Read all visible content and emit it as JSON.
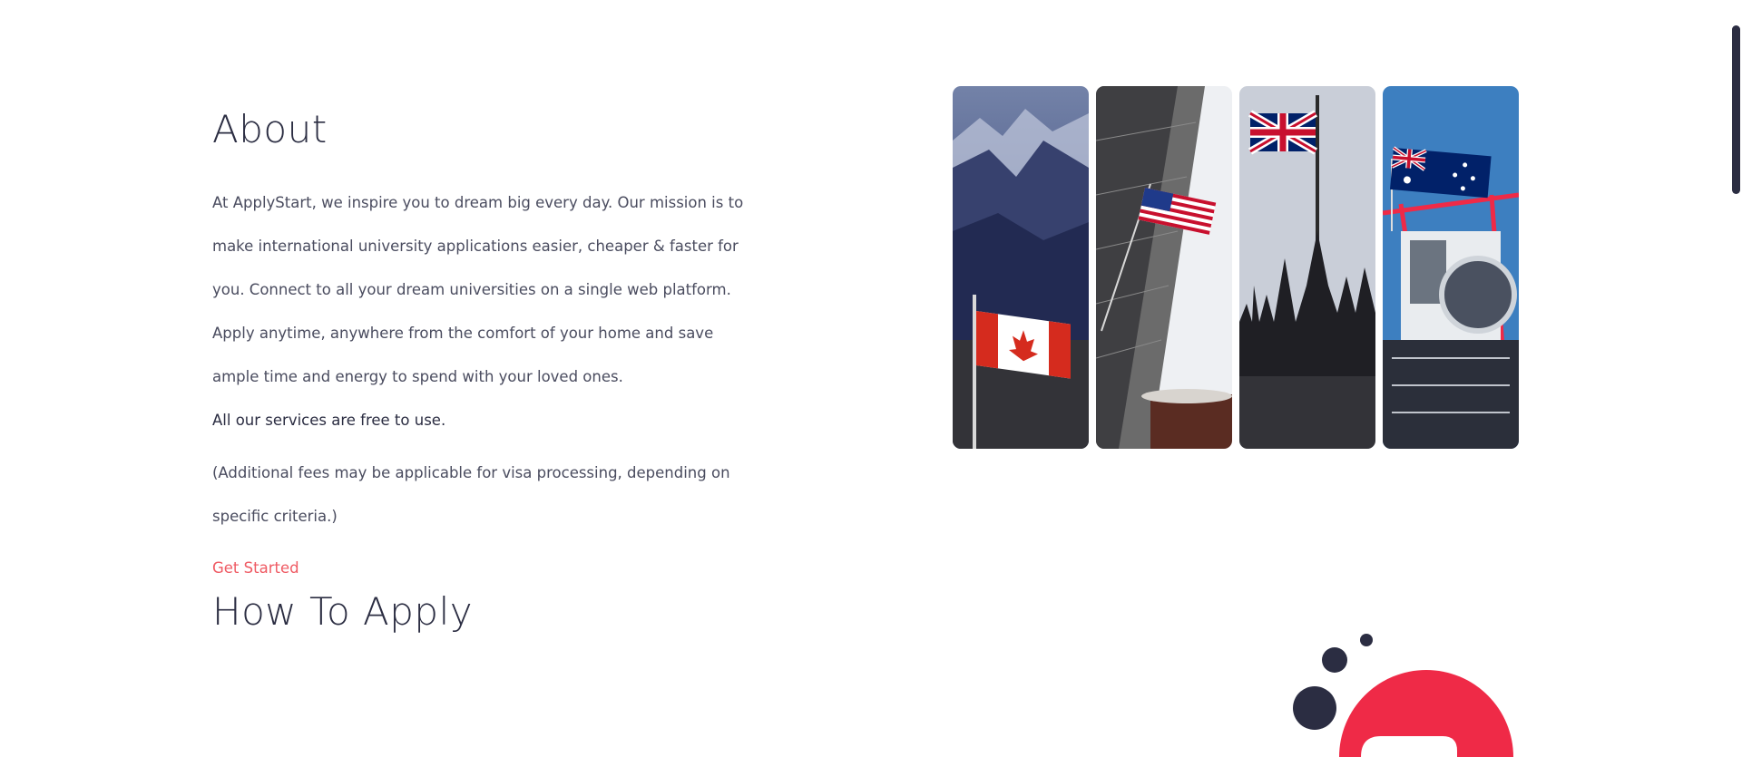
{
  "about": {
    "title": "About",
    "paragraph": "At ApplyStart, we inspire you to dream big every day. Our mission is to make international university applications easier, cheaper & faster for you. Connect to all your dream universities on a single web platform. Apply anytime, anywhere from the comfort of your home and save ample time and energy to spend with your loved ones.",
    "free_note": "All our services are free to use.",
    "fees_note": "(Additional fees may be applicable for visa processing, depending on specific criteria.)",
    "cta_label": "Get Started"
  },
  "how_to_apply": {
    "title": "How To Apply"
  },
  "gallery": {
    "panels": [
      {
        "country": "Canada",
        "icon": "canada-flag-mountains-image"
      },
      {
        "country": "United States",
        "icon": "usa-flag-skyscraper-image"
      },
      {
        "country": "United Kingdom",
        "icon": "uk-flag-westminster-image"
      },
      {
        "country": "Australia",
        "icon": "australia-flag-crane-image"
      }
    ]
  },
  "colors": {
    "text_dark": "#2b2d42",
    "text_body": "#4a4c5f",
    "accent": "#ef5a63",
    "decor_red": "#ef2a47",
    "decor_dark": "#2b2d42"
  }
}
